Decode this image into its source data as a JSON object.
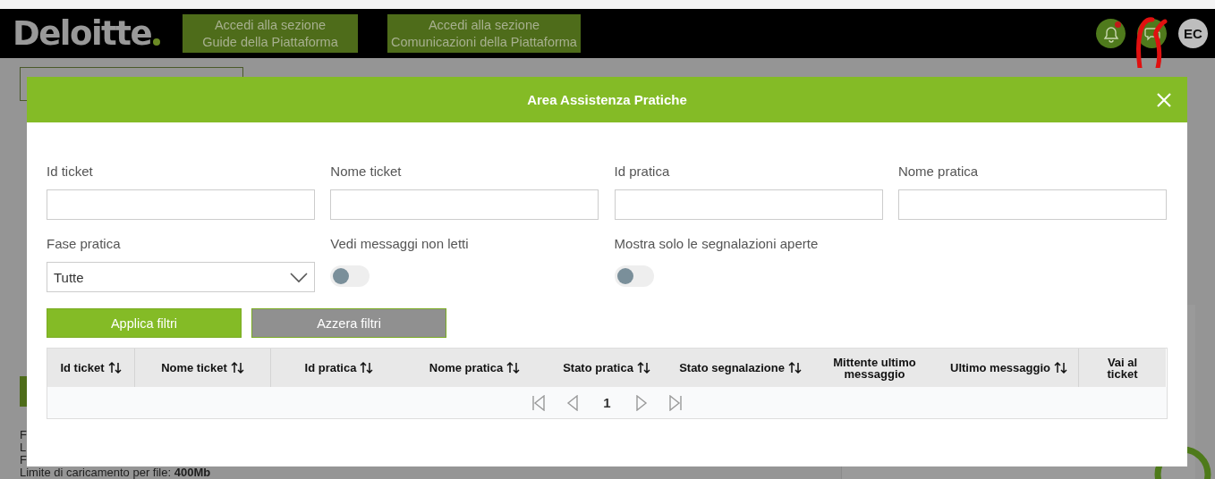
{
  "header": {
    "logo": "Deloitte",
    "section_buttons": [
      {
        "lines": [
          "Accedi alla sezione",
          "Guide della Piattaforma"
        ]
      },
      {
        "lines": [
          "Accedi alla sezione",
          "Comunicazioni della Piattaforma"
        ]
      }
    ],
    "notifications": {
      "unread": true
    },
    "avatar": "EC"
  },
  "background": {
    "lines": [
      "F",
      "L",
      "F",
      "Limite di caricamento per file: **400Mb**"
    ]
  },
  "modal": {
    "title": "Area Assistenza Pratiche",
    "filters": [
      {
        "kind": "text",
        "label": "Id ticket"
      },
      {
        "kind": "text",
        "label": "Nome ticket"
      },
      {
        "kind": "text",
        "label": "Id pratica"
      },
      {
        "kind": "text",
        "label": "Nome pratica"
      },
      {
        "kind": "select",
        "label": "Fase pratica",
        "value": "Tutte"
      },
      {
        "kind": "toggle",
        "label": "Vedi messaggi non letti",
        "on": false
      },
      {
        "kind": "toggle",
        "label": "Mostra solo le segnalazioni aperte",
        "on": false
      }
    ],
    "buttons": [
      {
        "kind": "primary",
        "label": "Applica filtri"
      },
      {
        "kind": "secondary",
        "label": "Azzera filtri"
      }
    ],
    "table": {
      "columns": [
        {
          "label": "Id ticket",
          "sortable": true
        },
        {
          "label": "Nome ticket",
          "sortable": true
        },
        {
          "label": "Id pratica",
          "sortable": true
        },
        {
          "label": "Nome pratica",
          "sortable": true
        },
        {
          "label": "Stato pratica",
          "sortable": true
        },
        {
          "label": "Stato segnalazione",
          "sortable": true
        },
        {
          "label": "Mittente ultimo messaggio",
          "sortable": false
        },
        {
          "label": "Ultimo messaggio",
          "sortable": true
        },
        {
          "label": "Vai al ticket",
          "sortable": false
        }
      ],
      "page": "1"
    }
  }
}
